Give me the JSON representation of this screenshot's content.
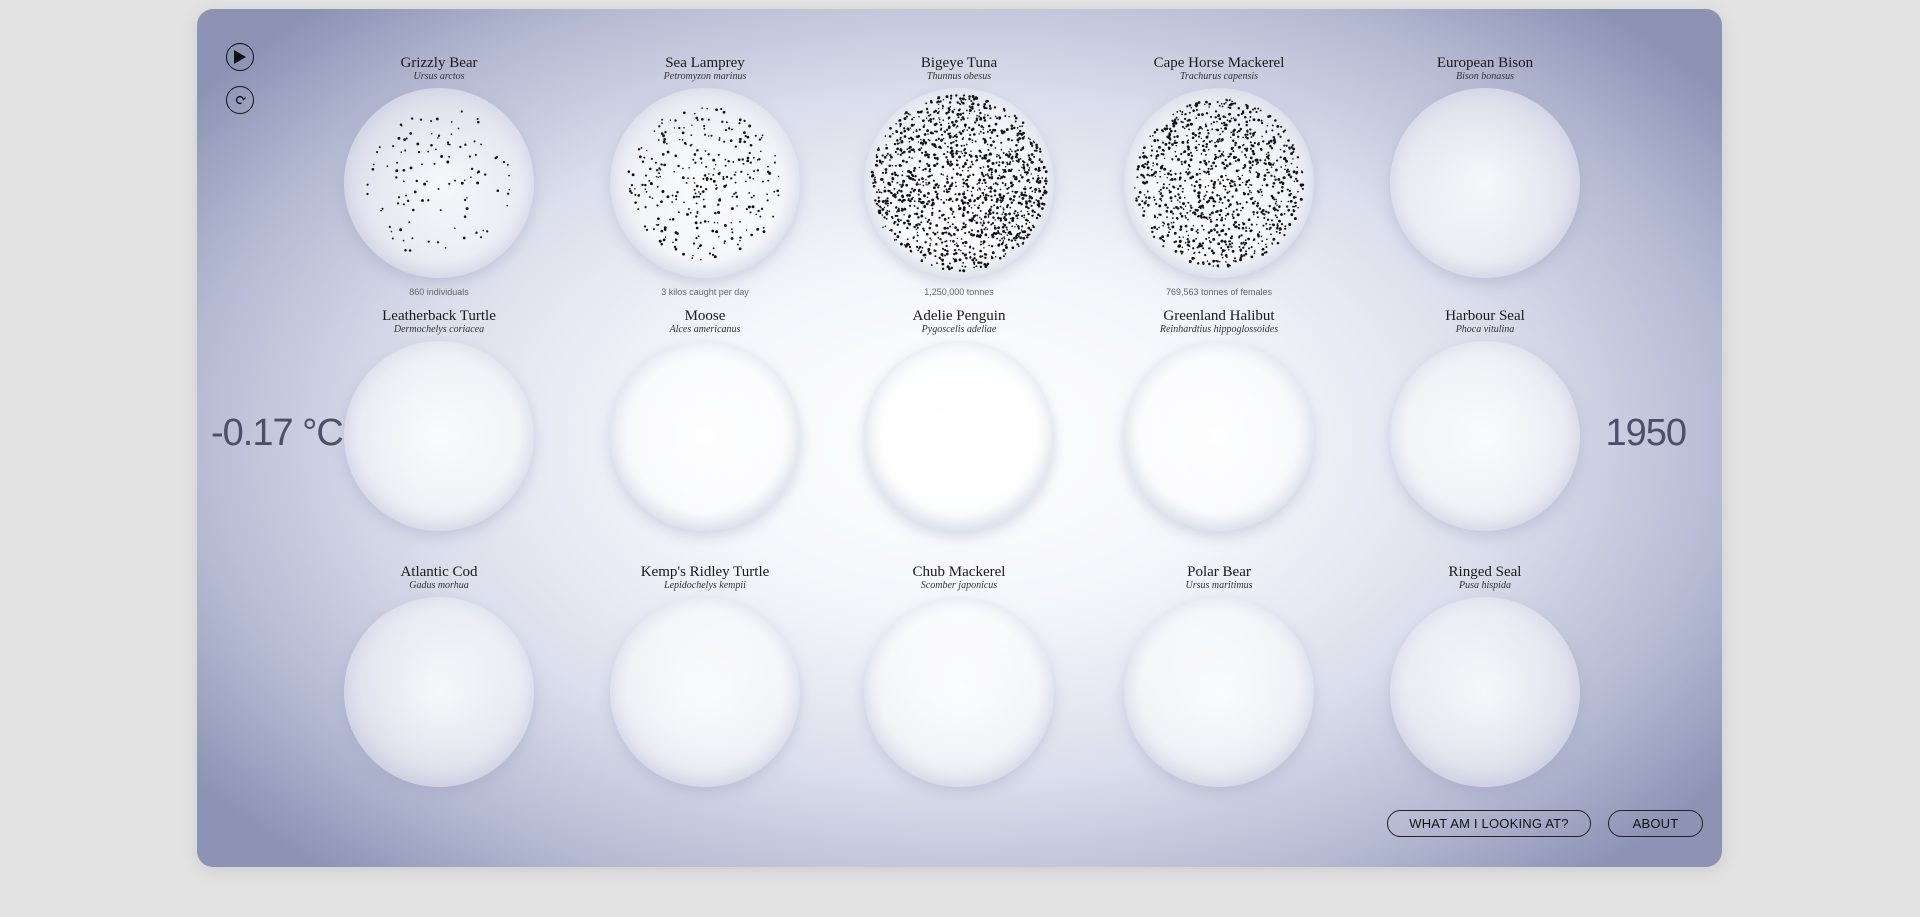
{
  "temperature": "-0.17 °C",
  "year": "1950",
  "controls": {
    "play_icon": "play-icon",
    "reset_icon": "refresh-icon"
  },
  "buttons": {
    "what": "WHAT AM I LOOKING AT?",
    "about": "ABOUT"
  },
  "species": [
    {
      "name": "Grizzly Bear",
      "latin": "Ursus arctos",
      "caption": "860 individuals",
      "density": 0.08
    },
    {
      "name": "Sea Lamprey",
      "latin": "Petromyzon marinus",
      "caption": "3 kilos caught per day",
      "density": 0.22
    },
    {
      "name": "Bigeye Tuna",
      "latin": "Thunnus obesus",
      "caption": "1,250,000 tonnes",
      "density": 1.0
    },
    {
      "name": "Cape Horse Mackerel",
      "latin": "Trachurus capensis",
      "caption": "769,563 tonnes of females",
      "density": 0.75
    },
    {
      "name": "European Bison",
      "latin": "Bison bonasus",
      "caption": "",
      "density": 0
    },
    {
      "name": "Leatherback Turtle",
      "latin": "Dermochelys coriacea",
      "caption": "",
      "density": 0
    },
    {
      "name": "Moose",
      "latin": "Alces americanus",
      "caption": "",
      "density": 0
    },
    {
      "name": "Adelie Penguin",
      "latin": "Pygoscelis adeliae",
      "caption": "",
      "density": 0
    },
    {
      "name": "Greenland Halibut",
      "latin": "Reinhardtius hippoglossoides",
      "caption": "",
      "density": 0
    },
    {
      "name": "Harbour Seal",
      "latin": "Phoca vitulina",
      "caption": "",
      "density": 0
    },
    {
      "name": "Atlantic Cod",
      "latin": "Gadus morhua",
      "caption": "",
      "density": 0
    },
    {
      "name": "Kemp's Ridley Turtle",
      "latin": "Lepidochelys kempii",
      "caption": "",
      "density": 0
    },
    {
      "name": "Chub Mackerel",
      "latin": "Scomber japonicus",
      "caption": "",
      "density": 0
    },
    {
      "name": "Polar Bear",
      "latin": "Ursus maritimus",
      "caption": "",
      "density": 0
    },
    {
      "name": "Ringed Seal",
      "latin": "Pusa hispida",
      "caption": "",
      "density": 0
    }
  ]
}
